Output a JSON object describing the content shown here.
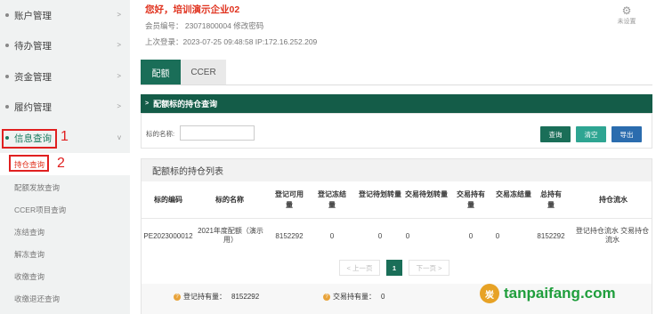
{
  "sidebar": {
    "items": [
      {
        "label": "账户管理"
      },
      {
        "label": "待办管理"
      },
      {
        "label": "资金管理"
      },
      {
        "label": "履约管理"
      },
      {
        "label": "信息查询"
      }
    ],
    "sub_items": [
      {
        "label": "持仓查询"
      },
      {
        "label": "配额发放查询"
      },
      {
        "label": "CCER项目查询"
      },
      {
        "label": "冻结查询"
      },
      {
        "label": "解冻查询"
      },
      {
        "label": "收缴查询"
      },
      {
        "label": "收缴退还查询"
      }
    ],
    "annotations": [
      "1",
      "2"
    ]
  },
  "header": {
    "greeting": "您好，培训演示企业02",
    "member_line": "会员编号： 23071800004  修改密码",
    "last_login": "上次登录：2023-07-25 09:48:58   IP:172.16.252.209",
    "settings_label": "未设置"
  },
  "tabs": [
    {
      "label": "配额"
    },
    {
      "label": "CCER"
    }
  ],
  "query": {
    "panel_title": "配额标的持仓查询",
    "field_label": "标的名称:",
    "field_value": "",
    "buttons": {
      "search": "查询",
      "clear": "清空",
      "export": "导出"
    }
  },
  "list": {
    "title": "配额标的持仓列表",
    "columns": [
      "标的编码",
      "标的名称",
      "登记可用量",
      "登记冻结量",
      "登记待划转量",
      "交易待划转量",
      "交易持有量",
      "交易冻结量",
      "总持有量",
      "持仓流水"
    ],
    "row": [
      "PE2023000012",
      "2021年度配额（演示用）",
      "8152292",
      "0",
      "0",
      "0",
      "0",
      "0",
      "8152292",
      "登记持仓流水 交易持仓流水"
    ],
    "pager": {
      "prev": "< 上一页",
      "current": "1",
      "next": "下一页 >"
    },
    "summary": {
      "registered_label": "登记持有量：",
      "registered_value": "8152292",
      "trade_label": "交易持有量：",
      "trade_value": "0"
    }
  },
  "watermark": {
    "text": "tanpaifang.com",
    "logo_text": "炭"
  },
  "colors": {
    "accent": "#1a6e58",
    "red": "#e02020",
    "watermark": "#1f9e3c"
  }
}
